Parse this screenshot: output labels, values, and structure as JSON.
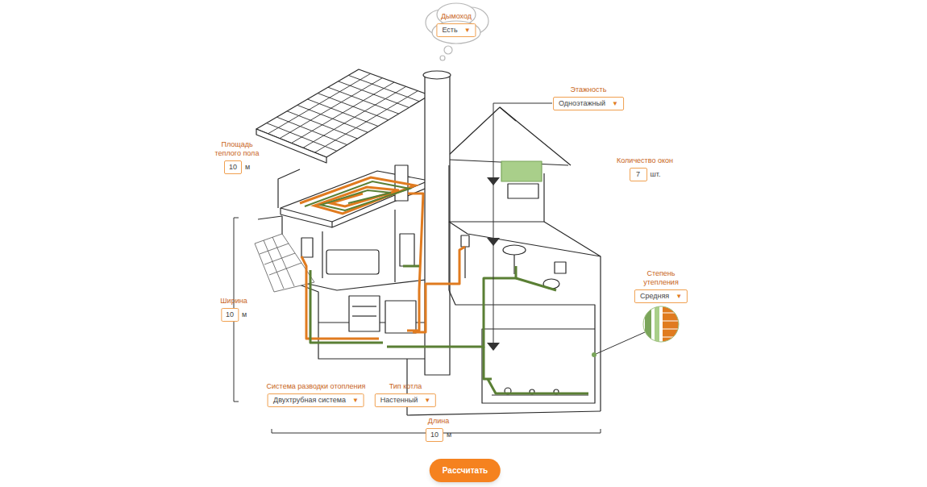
{
  "calculator": {
    "fields": [
      {
        "label": "Дымоход",
        "kind": "select",
        "value": "Есть",
        "arrow": "▼"
      },
      {
        "label": "Этажность",
        "kind": "select",
        "value": "Одноэтажный",
        "arrow": "▼"
      },
      {
        "label": "Количество окон",
        "kind": "number",
        "value": "7",
        "unit": "шт."
      },
      {
        "label": "Площадь теплого пола",
        "kind": "number",
        "value": "10",
        "unit": "м"
      },
      {
        "label": "Ширина",
        "kind": "number",
        "value": "10",
        "unit": "м"
      },
      {
        "label": "Степень утепления",
        "kind": "select",
        "value": "Средняя",
        "arrow": "▼"
      },
      {
        "label": "Система разводки отопления",
        "kind": "select",
        "value": "Двухтрубная система",
        "arrow": "▼"
      },
      {
        "label": "Тип котла",
        "kind": "select",
        "value": "Настенный",
        "arrow": "▼"
      },
      {
        "label": "Длина",
        "kind": "number",
        "value": "10",
        "unit": "м"
      }
    ],
    "button": "Рассчитать"
  }
}
